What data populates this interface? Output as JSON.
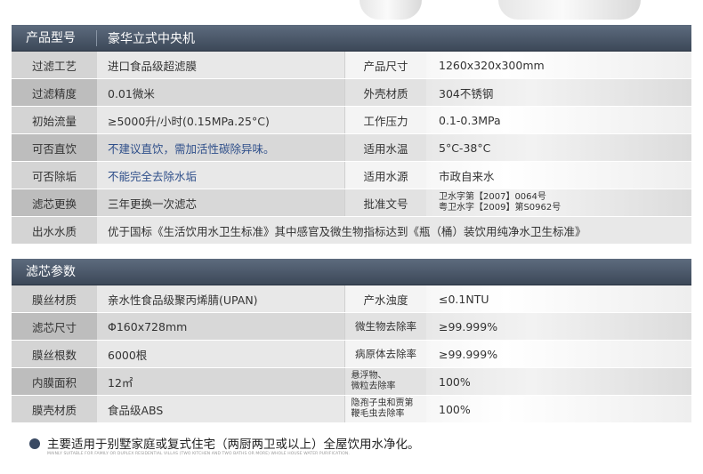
{
  "section1": {
    "header_label": "产品型号",
    "header_value": "豪华立式中央机",
    "rows": [
      {
        "l1": "过滤工艺",
        "v1": "进口食品级超滤膜",
        "l2": "产品尺寸",
        "v2": "1260x320x300mm"
      },
      {
        "l1": "过滤精度",
        "v1": "0.01微米",
        "l2": "外壳材质",
        "v2": "304不锈钢"
      },
      {
        "l1": "初始流量",
        "v1": "≥5000升/小时(0.15MPa.25°C)",
        "l2": "工作压力",
        "v2": "0.1-0.3MPa"
      },
      {
        "l1": "可否直饮",
        "v1": "不建议直饮，需加活性碳除异味。",
        "l2": "适用水温",
        "v2": "5°C-38°C"
      },
      {
        "l1": "可否除垢",
        "v1": "不能完全去除水垢",
        "l2": "适用水源",
        "v2": "市政自来水"
      },
      {
        "l1": "滤芯更换",
        "v1": "三年更换一次滤芯",
        "l2": "批准文号",
        "v2a": "卫水字第【2007】0064号",
        "v2b": "粤卫水字【2009】第S0962号"
      }
    ],
    "water_quality": {
      "label": "出水水质",
      "value": "优于国标《生活饮用水卫生标准》其中感官及微生物指标达到《瓶（桶）装饮用纯净水卫生标准》"
    }
  },
  "section2": {
    "header_label": "滤芯参数",
    "rows": [
      {
        "l1": "膜丝材质",
        "v1": "亲水性食品级聚丙烯腈(UPAN)",
        "l2": "产水浊度",
        "v2": "≤0.1NTU"
      },
      {
        "l1": "滤芯尺寸",
        "v1": "Φ160x728mm",
        "l2": "微生物去除率",
        "v2": "≥99.999%"
      },
      {
        "l1": "膜丝根数",
        "v1": "6000根",
        "l2": "病原体去除率",
        "v2": "≥99.999%"
      },
      {
        "l1": "内膜面积",
        "v1": "12㎡",
        "l2a": "悬浮物、",
        "l2b": "微粒去除率",
        "v2": "100%"
      },
      {
        "l1": "膜壳材质",
        "v1": "食品级ABS",
        "l2a": "隐孢子虫和贾第",
        "l2b": "鞭毛虫去除率",
        "v2": "100%"
      }
    ]
  },
  "footer": {
    "text": "主要适用于别墅家庭或复式住宅（两厨两卫或以上）全屋饮用水净化。",
    "subtext": "MAINLY SUITABLE FOR FAMILY OR DUPLEX RESIDENTIAL VILLAS (TWO KITCHEN AND TWO BATHS OR MORE) WHOLE HOUSE WATER PURIFICATION."
  }
}
